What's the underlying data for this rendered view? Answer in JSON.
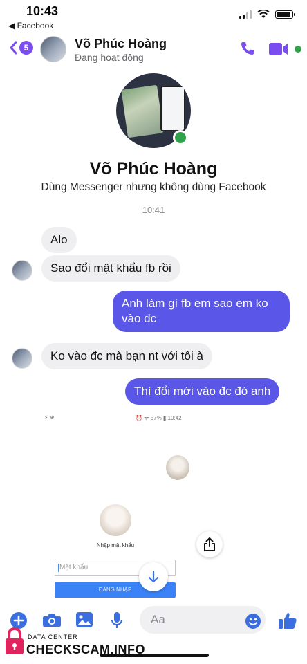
{
  "status_bar": {
    "time": "10:43",
    "back_app": "◀ Facebook"
  },
  "header": {
    "unread_count": "5",
    "contact_name": "Võ Phúc Hoàng",
    "contact_status": "Đang hoạt động"
  },
  "profile": {
    "name": "Võ Phúc Hoàng",
    "subtitle": "Dùng Messenger nhưng không dùng Facebook"
  },
  "conversation": {
    "timestamp": "10:41",
    "messages": [
      {
        "direction": "incoming",
        "text": "Alo"
      },
      {
        "direction": "incoming",
        "text": "Sao đổi mật khẩu fb rồi"
      },
      {
        "direction": "outgoing",
        "text": "Anh làm gì fb em sao em ko vào đc"
      },
      {
        "direction": "incoming",
        "text": "Ko vào đc mà bạn nt với tôi à"
      },
      {
        "direction": "outgoing",
        "text": "Thì đổi mới vào đc đó anh"
      }
    ]
  },
  "attached_screenshot": {
    "status_left": "⚡ ⊕",
    "status_right": "⏰ ᯤ 57% ▮ 10:42",
    "label": "Nhập mật khẩu",
    "password_placeholder": "Mật khẩu",
    "login_button": "ĐĂNG NHẬP"
  },
  "composer": {
    "placeholder": "Aa"
  },
  "watermark": {
    "line1": "DATA CENTER",
    "line2": "CHECKSCAM.INFO"
  },
  "colors": {
    "accent": "#7b4cf0",
    "outgoing_bubble": "#5a57e8",
    "incoming_bubble": "#efeff1",
    "online": "#31a24c"
  },
  "icons": [
    "back-chevron-icon",
    "phone-icon",
    "video-camera-icon",
    "share-icon",
    "download-icon",
    "plus-icon",
    "camera-icon",
    "image-icon",
    "microphone-icon",
    "emoji-icon",
    "thumbs-up-icon",
    "lock-icon"
  ]
}
